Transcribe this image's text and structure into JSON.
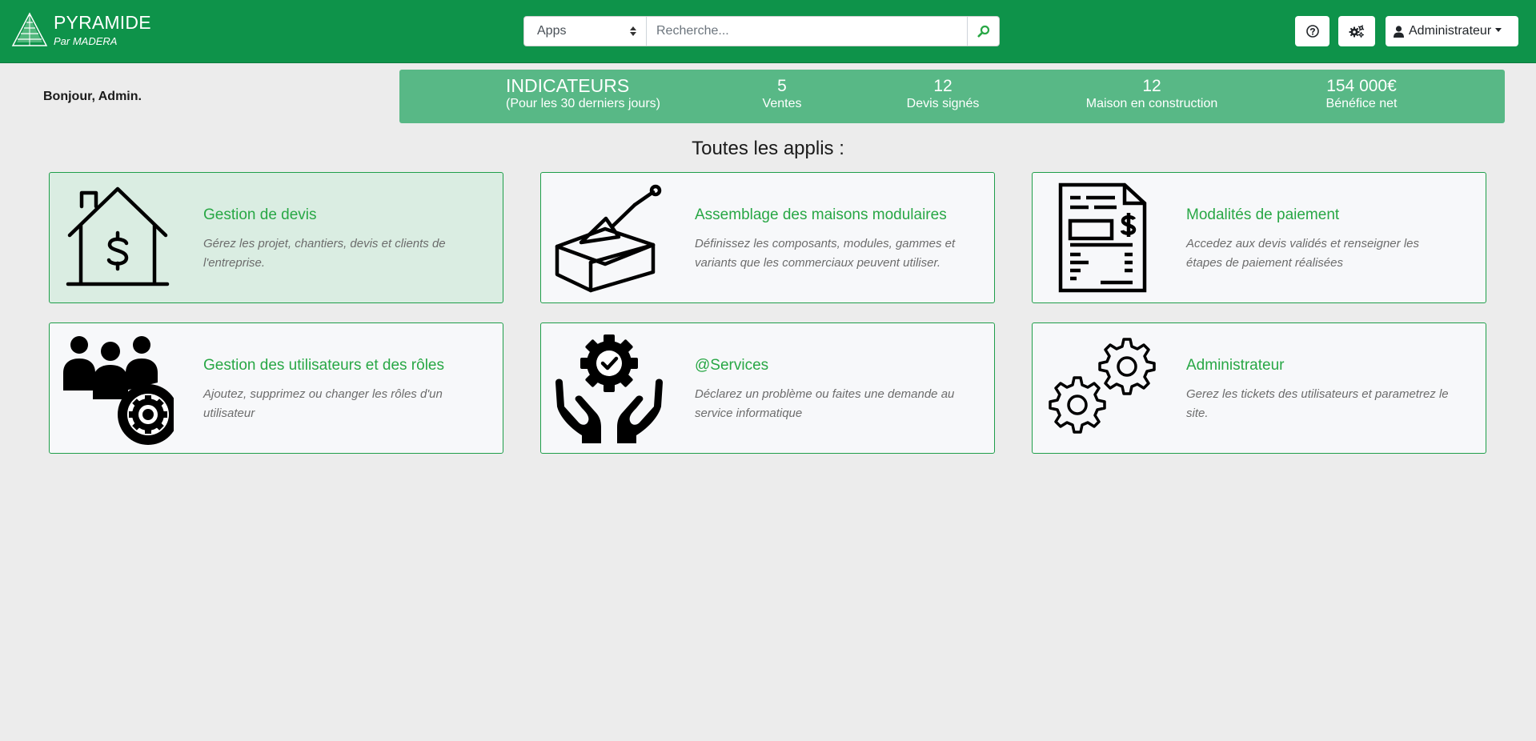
{
  "brand": {
    "title": "PYRAMIDE",
    "subtitle": "Par MADERA"
  },
  "search": {
    "select_value": "Apps",
    "placeholder": "Recherche..."
  },
  "user_menu": {
    "label": "Administrateur"
  },
  "greeting": "Bonjour, Admin.",
  "indicators": {
    "title": "INDICATEURS",
    "period": "(Pour les 30 derniers jours)",
    "items": [
      {
        "value": "5",
        "label": "Ventes"
      },
      {
        "value": "12",
        "label": "Devis signés"
      },
      {
        "value": "12",
        "label": "Maison en construction"
      },
      {
        "value": "154 000€",
        "label": "Bénéfice net"
      }
    ]
  },
  "section_title": "Toutes les applis :",
  "apps": [
    {
      "title": "Gestion de devis",
      "description": "Gérez les projet, chantiers, devis et clients de l'entreprise.",
      "icon": "house-dollar-icon"
    },
    {
      "title": "Assemblage des maisons modulaires",
      "description": "Définissez les composants, modules, gammes et variants que les commerciaux peuvent utiliser.",
      "icon": "brick-trowel-icon"
    },
    {
      "title": "Modalités de paiement",
      "description": "Accedez aux devis validés et renseigner les étapes de paiement réalisées",
      "icon": "invoice-icon"
    },
    {
      "title": "Gestion des utilisateurs et des rôles",
      "description": "Ajoutez, supprimez ou changer les rôles d'un utilisateur",
      "icon": "users-gear-icon"
    },
    {
      "title": "@Services",
      "description": "Déclarez un problème ou faites une demande au service informatique",
      "icon": "hands-gear-icon"
    },
    {
      "title": "Administrateur",
      "description": "Gerez les tickets des utilisateurs et parametrez le site.",
      "icon": "gears-icon"
    }
  ],
  "colors": {
    "navbar": "#0e934a",
    "indicators_bg": "#58b886",
    "accent": "#28a745"
  }
}
